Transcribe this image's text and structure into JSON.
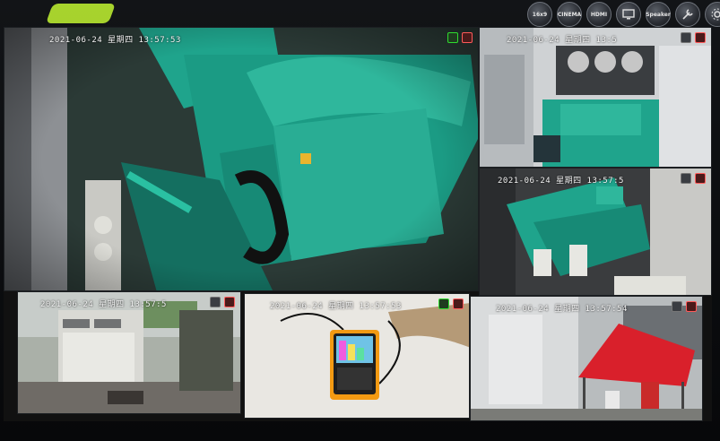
{
  "toolbar": {
    "buttons": [
      {
        "icon": "16-split-icon",
        "label": "16x9"
      },
      {
        "icon": "cinema-icon",
        "label": "CINEMA"
      },
      {
        "icon": "hdmi-icon",
        "label": "HDMI"
      },
      {
        "icon": "display-icon",
        "label": "DISP"
      },
      {
        "icon": "speaker-icon",
        "label": "Speaker"
      },
      {
        "icon": "tools-icon",
        "label": ""
      },
      {
        "icon": "settings-icon",
        "label": ""
      }
    ]
  },
  "cameras": [
    {
      "id": "cam1",
      "timestamp": "2021-06-24  星期四  13:57:53",
      "scene": "generator engine close-up"
    },
    {
      "id": "cam2",
      "timestamp": "2021-06-24  星期四  13:5",
      "scene": "generator room overview"
    },
    {
      "id": "cam3",
      "timestamp": "2021-06-24  星期四  13:57:5",
      "scene": "generator top view"
    },
    {
      "id": "cam4",
      "timestamp": "2021-06-24  星期四  13:57:5",
      "scene": "outdoor container"
    },
    {
      "id": "cam5",
      "timestamp": "2021-06-24  星期四  13:57:53",
      "scene": "power analyzer"
    },
    {
      "id": "cam6",
      "timestamp": "2021-06-24  星期四  13:57:54",
      "scene": "outdoor canopy"
    }
  ],
  "colors": {
    "engine": "#1fa48c",
    "engine_dark": "#0b5e50",
    "room": "#d8d8d8",
    "canopy": "#d9202b",
    "analyzer": "#f39a12",
    "status_run": "#2fdc2f",
    "status_rec": "#ff5a5a"
  }
}
